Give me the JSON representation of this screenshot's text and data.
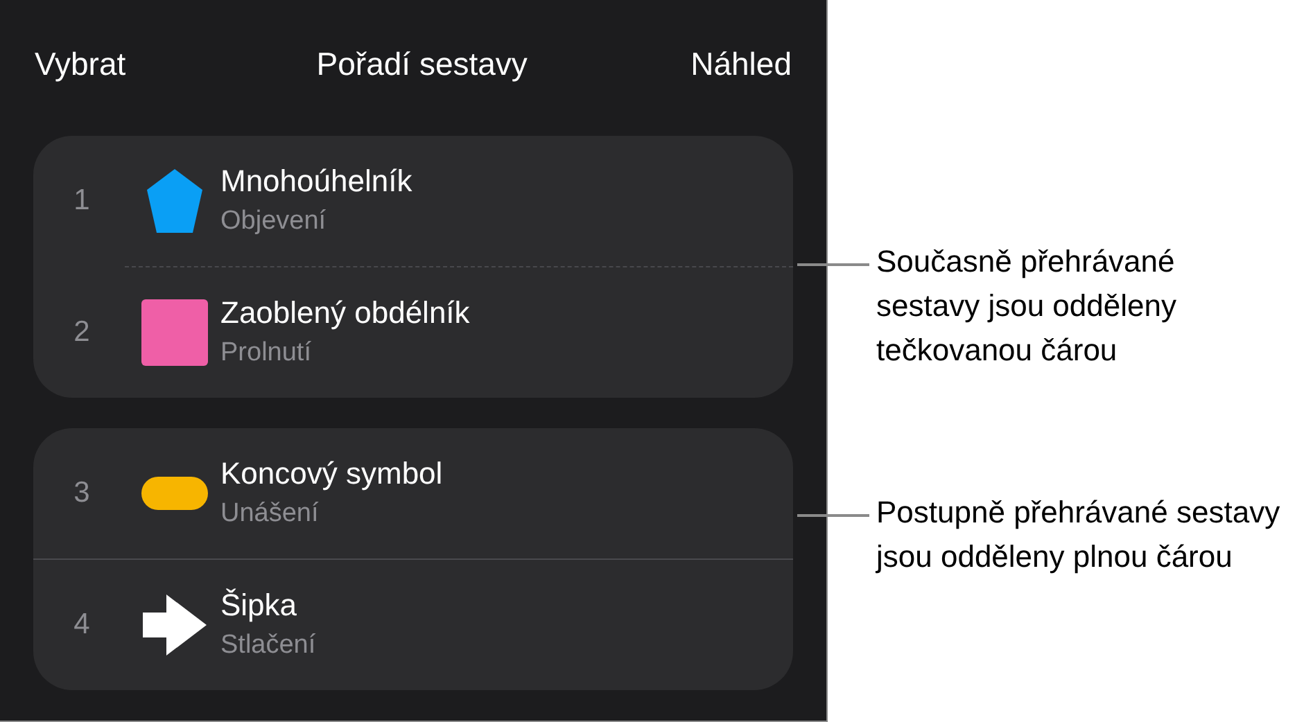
{
  "header": {
    "left": "Vybrat",
    "title": "Pořadí sestavy",
    "right": "Náhled"
  },
  "groups": [
    {
      "kind": "dotted",
      "items": [
        {
          "number": "1",
          "kind": "pentagon",
          "color": "#0a9ff5",
          "title": "Mnohoúhelník",
          "subtitle": "Objevení"
        },
        {
          "number": "2",
          "kind": "square",
          "color": "#ef5fa7",
          "title": "Zaoblený obdélník",
          "subtitle": "Prolnutí"
        }
      ]
    },
    {
      "kind": "solid",
      "items": [
        {
          "number": "3",
          "kind": "pill",
          "color": "#f7b500",
          "title": "Koncový symbol",
          "subtitle": "Unášení"
        },
        {
          "number": "4",
          "kind": "arrow",
          "color": "#ffffff",
          "title": "Šipka",
          "subtitle": "Stlačení"
        }
      ]
    }
  ],
  "callouts": [
    "Současně přehrávané sestavy jsou odděleny tečkovanou čárou",
    "Postupně přehrávané sestavy jsou odděleny plnou čárou"
  ]
}
